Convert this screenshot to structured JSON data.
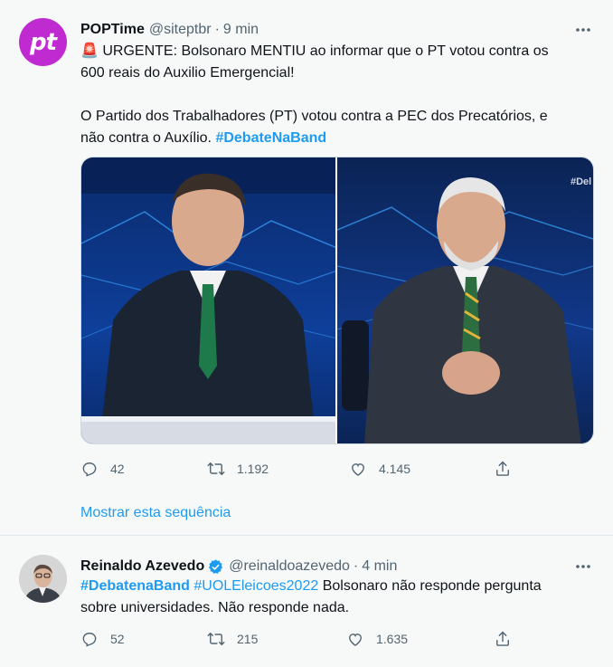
{
  "tweet1": {
    "author_name": "POPTime",
    "handle": "@siteptbr",
    "separator": "·",
    "time": "9 min",
    "avatar_text": "pt",
    "emoji": "🚨",
    "line1": "URGENTE: Bolsonaro MENTIU ao informar que o PT votou contra os",
    "line2": "600 reais do Auxilio Emergencial!",
    "line3": "O Partido dos Trabalhadores (PT) votou contra a PEC dos Precatórios, e",
    "line4_prefix": "não contra o Auxílio.",
    "hashtag": "#DebateNaBand",
    "media_overlay": "#Del",
    "replies": "42",
    "retweets": "1.192",
    "likes": "4.145",
    "show_thread": "Mostrar esta sequência"
  },
  "tweet2": {
    "author_name": "Reinaldo Azevedo",
    "handle": "@reinaldoazevedo",
    "separator": "·",
    "time": "4 min",
    "hashtag1": "#DebatenaBand",
    "hashtag2": "#UOLEleicoes2022",
    "line1_rest": "Bolsonaro não responde pergunta",
    "line2": "sobre universidades. Não responde nada.",
    "replies": "52",
    "retweets": "215",
    "likes": "1.635"
  },
  "more_icon": "more-horizontal-icon",
  "colors": {
    "link": "#1d9bf0",
    "secondary_text": "#536471",
    "avatar_brand": "#c02bd1",
    "background": "#f7f9f9",
    "verified": "#1d9bf0"
  }
}
